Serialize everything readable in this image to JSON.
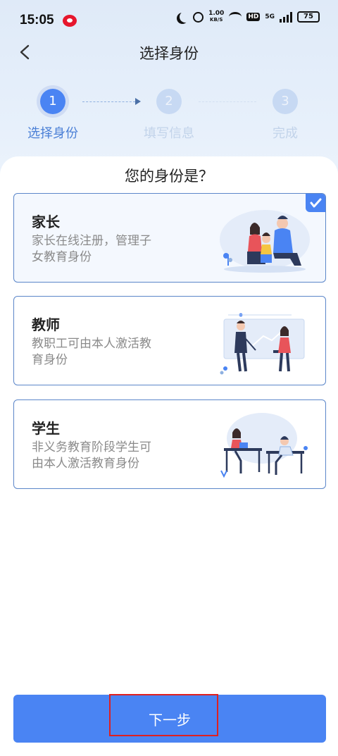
{
  "status_bar": {
    "time": "15:05",
    "network_speed_value": "1.00",
    "network_speed_unit": "KB/S",
    "hd_label": "HD",
    "network_type": "5G",
    "battery": "75"
  },
  "header": {
    "title": "选择身份"
  },
  "stepper": {
    "steps": [
      {
        "number": "1",
        "label": "选择身份",
        "state": "active"
      },
      {
        "number": "2",
        "label": "填写信息",
        "state": "inactive"
      },
      {
        "number": "3",
        "label": "完成",
        "state": "inactive"
      }
    ]
  },
  "question": "您的身份是？",
  "roles": [
    {
      "title": "家长",
      "description": "家长在线注册，管理子女教育身份",
      "selected": true,
      "illustration": "family-illustration"
    },
    {
      "title": "教师",
      "description": "教职工可由本人激活教育身份",
      "selected": false,
      "illustration": "teacher-illustration"
    },
    {
      "title": "学生",
      "description": "非义务教育阶段学生可由本人激活教育身份",
      "selected": false,
      "illustration": "student-illustration"
    }
  ],
  "footer": {
    "next_label": "下一步"
  },
  "colors": {
    "accent": "#4a84f3",
    "card_border": "#5b86c9",
    "step_active_text": "#4a7fd6",
    "step_inactive": "#c7d9f3",
    "highlight": "#e0201f"
  }
}
